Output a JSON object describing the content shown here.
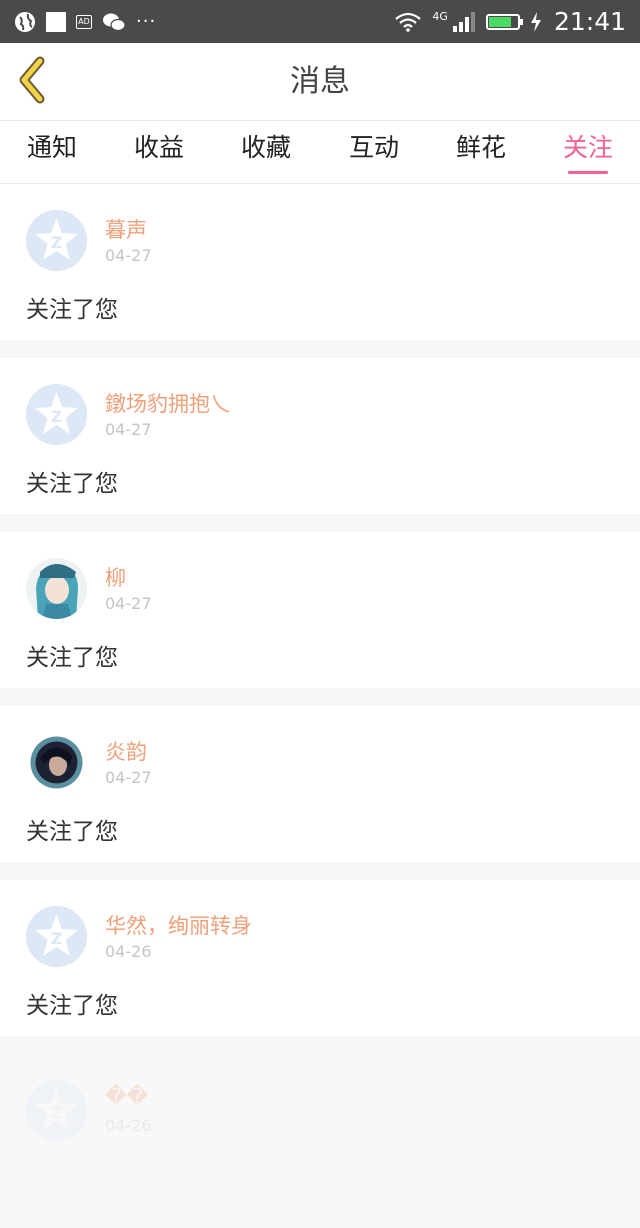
{
  "status_bar": {
    "network": "4G",
    "time": "21:41",
    "battery_level": 0.8,
    "icons": [
      "globe-icon",
      "square-icon",
      "ad-icon",
      "wechat-icon",
      "more-dots-icon",
      "wifi-icon",
      "signal-icon",
      "battery-icon",
      "charging-icon"
    ]
  },
  "header": {
    "title": "消息",
    "back_icon": "chevron-left-icon"
  },
  "tabs": [
    {
      "label": "通知",
      "active": false
    },
    {
      "label": "收益",
      "active": false
    },
    {
      "label": "收藏",
      "active": false
    },
    {
      "label": "互动",
      "active": false
    },
    {
      "label": "鲜花",
      "active": false
    },
    {
      "label": "关注",
      "active": true
    }
  ],
  "colors": {
    "accent": "#f06292",
    "username": "#f0a07a",
    "date": "#c4c4c4",
    "status_bar": "#4a4a4a"
  },
  "notifications": [
    {
      "name": "暮声",
      "date": "04-27",
      "message": "关注了您",
      "avatar": "default-q-icon"
    },
    {
      "name": "鐓场豹拥抱乀",
      "date": "04-27",
      "message": "关注了您",
      "avatar": "default-q-icon"
    },
    {
      "name": "柳",
      "date": "04-27",
      "message": "关注了您",
      "avatar": "anime-avatar-blue"
    },
    {
      "name": "炎韵",
      "date": "04-27",
      "message": "关注了您",
      "avatar": "anime-avatar-dark"
    },
    {
      "name": "华然，绚丽转身",
      "date": "04-26",
      "message": "关注了您",
      "avatar": "default-q-icon"
    },
    {
      "name": "��",
      "date": "04-26",
      "message": "",
      "avatar": "default-q-icon"
    }
  ]
}
